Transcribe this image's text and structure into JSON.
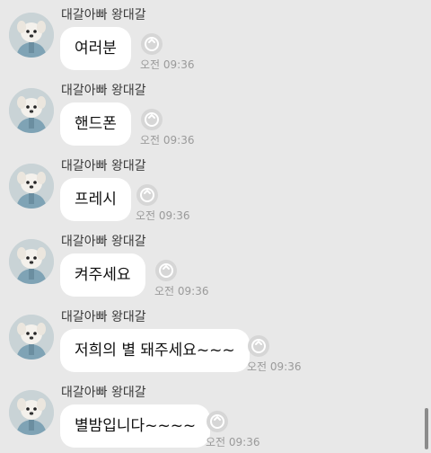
{
  "messages": [
    {
      "sender": "대갈아빠 왕대갈",
      "text": "여러분",
      "time": "오전 09:36",
      "read_icon": "reaction-add-icon"
    },
    {
      "sender": "대갈아빠 왕대갈",
      "text": "핸드폰",
      "time": "오전 09:36",
      "read_icon": "reaction-add-icon"
    },
    {
      "sender": "대갈아빠 왕대갈",
      "text": "프레시",
      "time": "오전 09:36",
      "read_icon": "reaction-add-icon"
    },
    {
      "sender": "대갈아빠 왕대갈",
      "text": "켜주세요",
      "time": "오전 09:36",
      "read_icon": "reaction-add-icon"
    },
    {
      "sender": "대갈아빠 왕대갈",
      "text": "저희의 별 돼주세요~~~",
      "time": "오전 09:36",
      "read_icon": "reaction-add-icon"
    },
    {
      "sender": "대갈아빠 왕대갈",
      "text": "별밤입니다~~~~",
      "time": "오전 09:36",
      "read_icon": "reaction-add-icon"
    }
  ],
  "colors": {
    "background": "#e8e8e8",
    "bubble": "#ffffff",
    "time": "#9a9a9a"
  }
}
